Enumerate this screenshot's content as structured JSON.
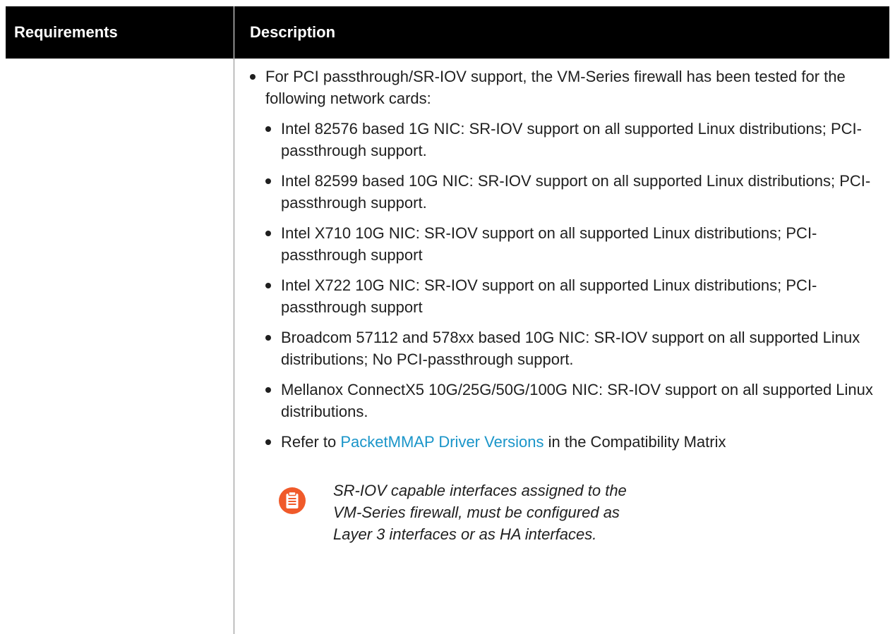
{
  "table": {
    "headers": {
      "requirements": "Requirements",
      "description": "Description"
    },
    "row": {
      "requirement": "",
      "intro": "For PCI passthrough/SR-IOV support, the VM-Series firewall has been tested for the following network cards:",
      "cards": [
        "Intel 82576 based 1G NIC: SR-IOV support on all supported Linux distributions; PCI-passthrough support.",
        "Intel 82599 based 10G NIC: SR-IOV support on all supported Linux distributions; PCI-passthrough support.",
        "Intel X710 10G NIC: SR-IOV support on all supported Linux distributions; PCI-passthrough support",
        "Intel X722 10G NIC: SR-IOV support on all supported Linux distributions; PCI-passthrough support",
        "Broadcom 57112 and 578xx based 10G NIC: SR-IOV support on all supported Linux distributions; No PCI-passthrough support.",
        "Mellanox ConnectX5 10G/25G/50G/100G NIC: SR-IOV support on all supported Linux distributions."
      ],
      "refer": {
        "prefix": "Refer to ",
        "link_text": "PacketMMAP Driver Versions",
        "suffix": " in the Compatibility Matrix"
      },
      "note": {
        "icon": "clipboard-note-icon",
        "text": "SR-IOV capable interfaces assigned to the VM-Series firewall, must be configured as Layer 3 interfaces or as HA interfaces."
      }
    }
  },
  "colors": {
    "header_bg": "#000000",
    "header_text": "#ffffff",
    "link": "#1a95c9",
    "note_icon": "#f05a2a"
  }
}
